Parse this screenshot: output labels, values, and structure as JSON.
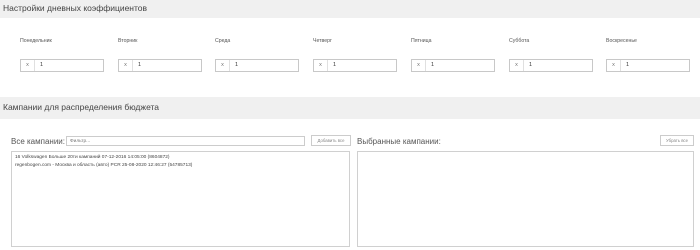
{
  "section1": {
    "title": "Настройки дневных коэффициентов"
  },
  "days": [
    {
      "label": "Понедельник",
      "clear": "x",
      "value": "1"
    },
    {
      "label": "Вторник",
      "clear": "x",
      "value": "1"
    },
    {
      "label": "Среда",
      "clear": "x",
      "value": "1"
    },
    {
      "label": "Четверг",
      "clear": "x",
      "value": "1"
    },
    {
      "label": "Пятница",
      "clear": "x",
      "value": "1"
    },
    {
      "label": "Суббота",
      "clear": "x",
      "value": "1"
    },
    {
      "label": "Воскресенье",
      "clear": "x",
      "value": "1"
    }
  ],
  "section2": {
    "title": "Кампании для распределения бюджета"
  },
  "all_campaigns": {
    "label": "Все кампании:",
    "filter_placeholder": "Фильтр...",
    "add_all_label": "Добавить все",
    "items": [
      "16 Volkswagen Больше 20ти кампаний 07-12-2016 14:05:00 (8604872)",
      "regenbogen.com - Москва и область (авто) PCR 25-08-2020 12:46:27 (54785713)"
    ]
  },
  "selected_campaigns": {
    "label": "Выбранные кампании:",
    "remove_all_label": "Убрать все",
    "items": []
  }
}
